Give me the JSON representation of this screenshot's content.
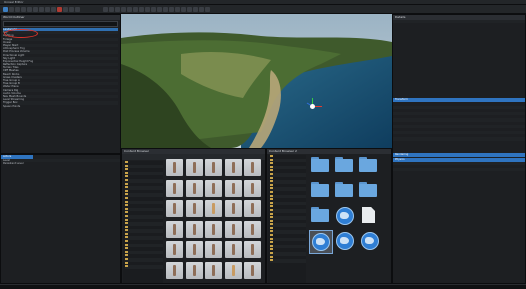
{
  "window": {
    "title": "Unreal Editor"
  },
  "menu": {
    "items": [
      "File",
      "Edit",
      "Window",
      "Tools",
      "Build",
      "Select",
      "Actor",
      "Help"
    ]
  },
  "outliner": {
    "title": "World Outliner",
    "search_placeholder": "Search...",
    "rows": [
      "Landscape",
      "Sky",
      "Lighting",
      "Foliage",
      "Ocean",
      "Player Start",
      "Atmospheric Fog",
      "Post Process Volume",
      "Directional Light",
      "Sky Light",
      "Exponential Height Fog",
      "Reflection Capture",
      "Terrain Tiles",
      "Cliff Meshes",
      "Beach Rocks",
      "Grass Clusters",
      "Tree Group A",
      "Tree Group B",
      "Water Plane",
      "Camera Rig",
      "Audio Volume",
      "Nav Mesh Bounds",
      "Level Streaming",
      "Trigger Box",
      "Spawn Points"
    ],
    "footer": "Actors"
  },
  "details": {
    "title": "Details",
    "sections": [
      "Transform",
      "Rendering",
      "Physics",
      "Collision",
      "Lighting"
    ]
  },
  "content": {
    "title": "Content Browser",
    "tab2": "Content Browser 2",
    "filter": "Filters"
  },
  "icons": {
    "gizmo": "transform-gizmo-icon",
    "folder": "folder-icon",
    "globe": "globe-icon",
    "doc": "document-icon"
  }
}
